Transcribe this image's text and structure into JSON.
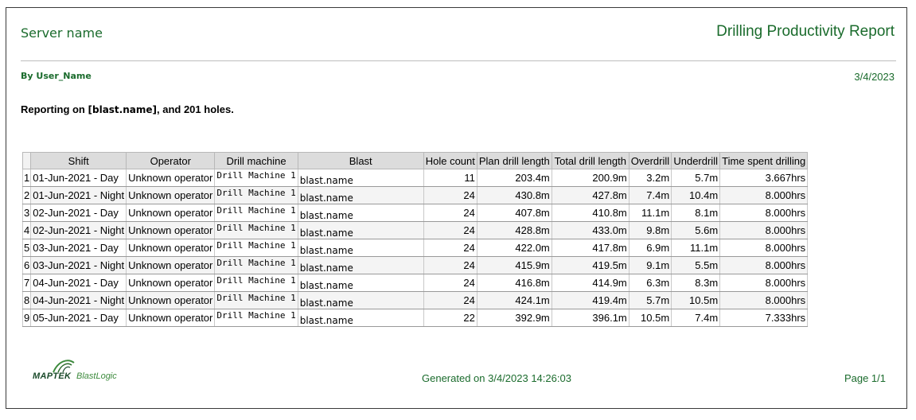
{
  "header": {
    "server_name": "Server name",
    "report_title": "Drilling Productivity Report",
    "by_user": "By User_Name",
    "date": "3/4/2023"
  },
  "reporting": {
    "prefix": "Reporting on ",
    "blast_token": "[blast.name]",
    "suffix": ", and 201 holes."
  },
  "table": {
    "columns": [
      "Shift",
      "Operator",
      "Drill machine",
      "Blast",
      "Hole count",
      "Plan drill length",
      "Total drill length",
      "Overdrill",
      "Underdrill",
      "Time spent drilling"
    ],
    "rows": [
      {
        "n": "1",
        "shift": "01-Jun-2021 - Day",
        "operator": "Unknown operator",
        "machine": "Drill Machine 1",
        "blast": "blast.name",
        "holes": "11",
        "plan": "203.4m",
        "total": "200.9m",
        "over": "3.2m",
        "under": "5.7m",
        "time": "3.667hrs"
      },
      {
        "n": "2",
        "shift": "01-Jun-2021 - Night",
        "operator": "Unknown operator",
        "machine": "Drill Machine 1",
        "blast": "blast.name",
        "holes": "24",
        "plan": "430.8m",
        "total": "427.8m",
        "over": "7.4m",
        "under": "10.4m",
        "time": "8.000hrs"
      },
      {
        "n": "3",
        "shift": "02-Jun-2021 - Day",
        "operator": "Unknown operator",
        "machine": "Drill Machine 1",
        "blast": "blast.name",
        "holes": "24",
        "plan": "407.8m",
        "total": "410.8m",
        "over": "11.1m",
        "under": "8.1m",
        "time": "8.000hrs"
      },
      {
        "n": "4",
        "shift": "02-Jun-2021 - Night",
        "operator": "Unknown operator",
        "machine": "Drill Machine 1",
        "blast": "blast.name",
        "holes": "24",
        "plan": "428.8m",
        "total": "433.0m",
        "over": "9.8m",
        "under": "5.6m",
        "time": "8.000hrs"
      },
      {
        "n": "5",
        "shift": "03-Jun-2021 - Day",
        "operator": "Unknown operator",
        "machine": "Drill Machine 1",
        "blast": "blast.name",
        "holes": "24",
        "plan": "422.0m",
        "total": "417.8m",
        "over": "6.9m",
        "under": "11.1m",
        "time": "8.000hrs"
      },
      {
        "n": "6",
        "shift": "03-Jun-2021 - Night",
        "operator": "Unknown operator",
        "machine": "Drill Machine 1",
        "blast": "blast.name",
        "holes": "24",
        "plan": "415.9m",
        "total": "419.5m",
        "over": "9.1m",
        "under": "5.5m",
        "time": "8.000hrs"
      },
      {
        "n": "7",
        "shift": "04-Jun-2021 - Day",
        "operator": "Unknown operator",
        "machine": "Drill Machine 1",
        "blast": "blast.name",
        "holes": "24",
        "plan": "416.8m",
        "total": "414.9m",
        "over": "6.3m",
        "under": "8.3m",
        "time": "8.000hrs"
      },
      {
        "n": "8",
        "shift": "04-Jun-2021 - Night",
        "operator": "Unknown operator",
        "machine": "Drill Machine 1",
        "blast": "blast.name",
        "holes": "24",
        "plan": "424.1m",
        "total": "419.4m",
        "over": "5.7m",
        "under": "10.5m",
        "time": "8.000hrs"
      },
      {
        "n": "9",
        "shift": "05-Jun-2021 - Day",
        "operator": "Unknown operator",
        "machine": "Drill Machine 1",
        "blast": "blast.name",
        "holes": "22",
        "plan": "392.9m",
        "total": "396.1m",
        "over": "10.5m",
        "under": "7.4m",
        "time": "7.333hrs"
      }
    ]
  },
  "footer": {
    "logo_brand": "MAPTEK",
    "logo_product": "BlastLogic",
    "generated": "Generated on 3/4/2023 14:26:03",
    "page": "Page 1/1"
  },
  "colors": {
    "accent_green": "#1a6b2c",
    "header_gray": "#dcdcdc"
  }
}
